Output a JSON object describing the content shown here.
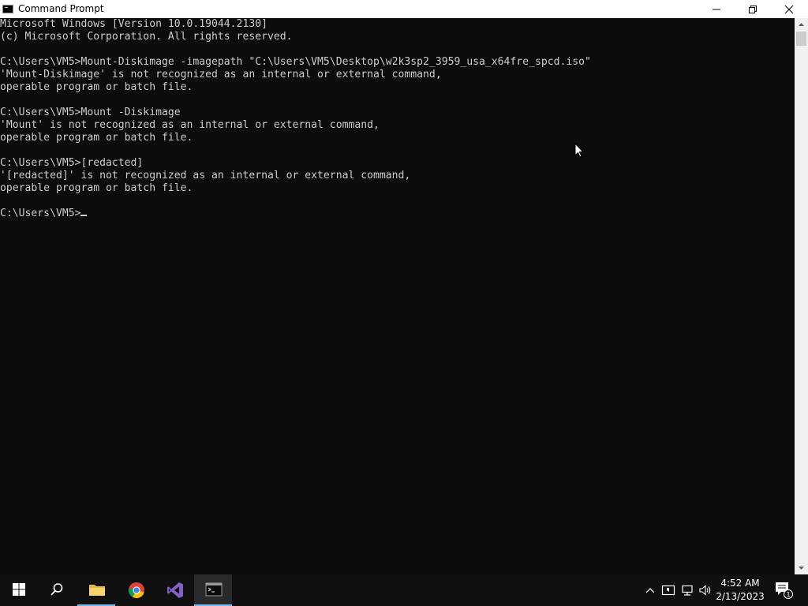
{
  "window": {
    "title": "Command Prompt",
    "icons": {
      "app": "cmd-icon",
      "minimize": "minimize-icon",
      "maximize": "restore-icon",
      "close": "close-icon"
    }
  },
  "console": {
    "lines": [
      "Microsoft Windows [Version 10.0.19044.2130]",
      "(c) Microsoft Corporation. All rights reserved.",
      "",
      "C:\\Users\\VM5>Mount-Diskimage -imagepath \"C:\\Users\\VM5\\Desktop\\w2k3sp2_3959_usa_x64fre_spcd.iso\"",
      "'Mount-Diskimage' is not recognized as an internal or external command,",
      "operable program or batch file.",
      "",
      "C:\\Users\\VM5>Mount -Diskimage",
      "'Mount' is not recognized as an internal or external command,",
      "operable program or batch file.",
      "",
      "C:\\Users\\VM5>[redacted]",
      "'[redacted]' is not recognized as an internal or external command,",
      "operable program or batch file.",
      "",
      "C:\\Users\\VM5>"
    ],
    "text_color": "#cccccc",
    "background": "#0c0c0c"
  },
  "taskbar": {
    "items": [
      {
        "name": "start-button",
        "icon": "windows-logo-icon"
      },
      {
        "name": "search-button",
        "icon": "search-icon"
      },
      {
        "name": "file-explorer-button",
        "icon": "folder-icon"
      },
      {
        "name": "chrome-button",
        "icon": "chrome-icon"
      },
      {
        "name": "visual-studio-button",
        "icon": "visual-studio-icon"
      },
      {
        "name": "command-prompt-button",
        "icon": "cmd-icon",
        "active": true
      }
    ],
    "tray_icons": [
      "chevron-up-icon",
      "security-icon",
      "network-icon",
      "volume-icon"
    ],
    "clock": {
      "time": "4:52 AM",
      "date": "2/13/2023"
    },
    "notifications": {
      "icon": "notification-icon",
      "count": "1"
    },
    "accent": "#76b9ed"
  }
}
